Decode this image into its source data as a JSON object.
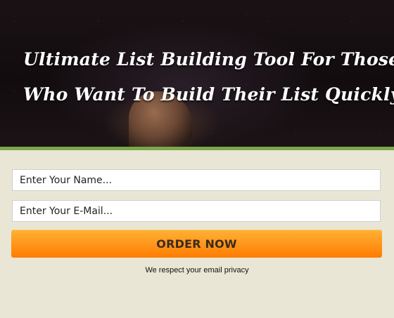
{
  "hero": {
    "headline_line1": "Ultimate List Building Tool For Those",
    "headline_line2": "Who Want To Build Their List Quickly"
  },
  "colors": {
    "accent_green": "#7ca84a",
    "button_orange": "#ff8c10",
    "form_background": "#e9e6d5"
  },
  "form": {
    "name_placeholder": "Enter Your Name...",
    "email_placeholder": "Enter Your E-Mail...",
    "submit_label": "ORDER NOW",
    "privacy_note": "We respect your email privacy"
  }
}
